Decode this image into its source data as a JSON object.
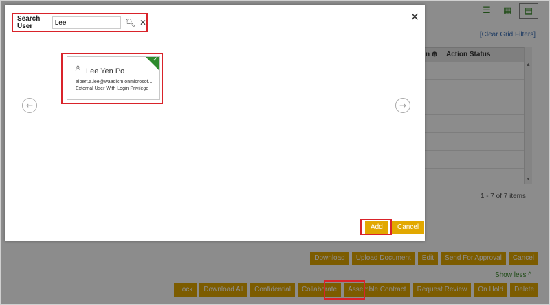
{
  "background": {
    "clear_grid_filters": "[Clear Grid Filters]",
    "grid_header": {
      "col1": "n",
      "col2": "Action Status"
    },
    "pager": "1 - 7 of 7 items",
    "action_row1": [
      "Download",
      "Upload Document",
      "Edit",
      "Send For Approval",
      "Cancel"
    ],
    "show_less": "Show less ^",
    "action_row2": [
      "Lock",
      "Download All",
      "Confidential",
      "Collaborate",
      "Assemble Contract",
      "Request Review",
      "On Hold",
      "Delete"
    ]
  },
  "modal": {
    "search_label": "Search User",
    "search_value": "Lee",
    "card": {
      "name": "Lee Yen Po",
      "email": "albert.a.lee@waadicm.onmicrosof...",
      "type": "External User With Login Privilege"
    },
    "add_label": "Add",
    "cancel_label": "Cancel"
  },
  "icons": {
    "list": "list-view-icon",
    "grid": "grid-view-icon",
    "table": "table-view-icon",
    "search": "search-icon",
    "clear": "clear-icon",
    "close": "close-icon",
    "prev": "arrow-left-circle-icon",
    "next": "arrow-right-circle-icon",
    "user": "user-icon",
    "check": "check-icon",
    "sort": "sort-icon"
  },
  "colors": {
    "accent": "#e2a800",
    "highlight": "#d9232a",
    "check": "#2e8b2e",
    "link": "#3b6fb6"
  }
}
